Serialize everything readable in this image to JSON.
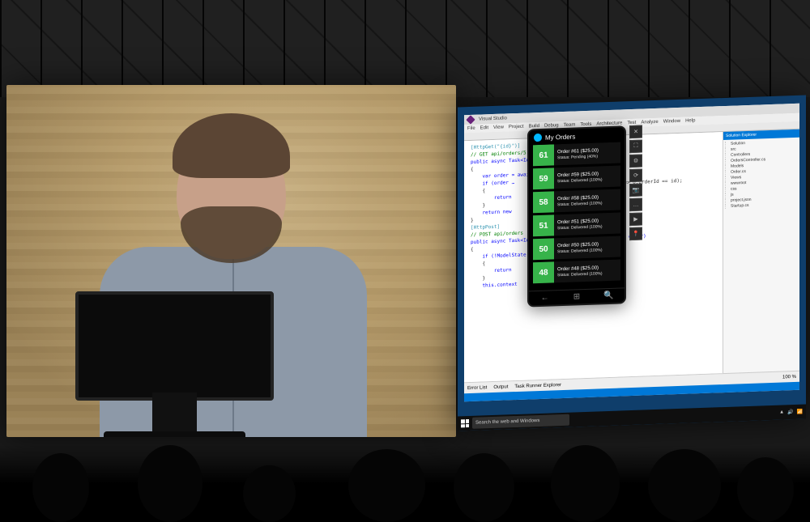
{
  "scene": {
    "description": "Conference stage with two projection screens: left shows a presenter at a podium, right shows a Windows 10 desktop running Visual Studio with a Windows Phone emulator in the foreground.",
    "audience_foreground": true
  },
  "ide": {
    "app_name": "Visual Studio",
    "menubar": [
      "File",
      "Edit",
      "View",
      "Project",
      "Build",
      "Debug",
      "Team",
      "Tools",
      "Architecture",
      "Test",
      "Analyze",
      "Window",
      "Help"
    ],
    "bottom_tabs": [
      "Error List",
      "Output",
      "Task Runner Explorer"
    ],
    "zoom": "100 %",
    "solution_explorer": {
      "title": "Solution Explorer",
      "items": [
        "Solution",
        "src",
        "  Controllers",
        "    OrdersController.cs",
        "  Models",
        "    Order.cs",
        "  Views",
        "  wwwroot",
        "    css",
        "    js",
        "  project.json",
        "  Startup.cs"
      ]
    },
    "code": {
      "lines": [
        {
          "cls": "code-attr",
          "text": "[HttpGet(\"{id}\")]"
        },
        {
          "cls": "code-comment",
          "text": "// GET api/orders/5"
        },
        {
          "cls": "code-kw",
          "text": "public async Task<IActionResult> Get(int id)"
        },
        {
          "cls": "",
          "text": "{"
        },
        {
          "cls": "code-kw",
          "text": "    var order = await _context."
        },
        {
          "cls": "code-kw",
          "text": "    if (order …"
        },
        {
          "cls": "",
          "text": "    {"
        },
        {
          "cls": "code-kw",
          "text": "        return"
        },
        {
          "cls": "",
          "text": "    }"
        },
        {
          "cls": "",
          "text": ""
        },
        {
          "cls": "code-kw",
          "text": "    return new"
        },
        {
          "cls": "",
          "text": "}"
        },
        {
          "cls": "",
          "text": ""
        },
        {
          "cls": "code-attr",
          "text": "[HttpPost]"
        },
        {
          "cls": "code-comment",
          "text": "// POST api/orders"
        },
        {
          "cls": "code-kw",
          "text": "public async Task<IActionResult> Post([FromBody]Order order)"
        },
        {
          "cls": "",
          "text": "{"
        },
        {
          "cls": "code-kw",
          "text": "    if (!ModelState"
        },
        {
          "cls": "",
          "text": "    {"
        },
        {
          "cls": "code-kw",
          "text": "        return"
        },
        {
          "cls": "",
          "text": "    }"
        },
        {
          "cls": "",
          "text": ""
        },
        {
          "cls": "code-kw",
          "text": "    this.context"
        }
      ],
      "fragment_behind_phone": "aultAsync(o => o.OrderId == id);"
    }
  },
  "phone": {
    "app_title": "My Orders",
    "orders": [
      {
        "num": "61",
        "title": "Order #61 ($25.00)",
        "status": "Status: Pending (40%)"
      },
      {
        "num": "59",
        "title": "Order #59 ($25.00)",
        "status": "Status: Delivered (100%)"
      },
      {
        "num": "58",
        "title": "Order #58 ($25.00)",
        "status": "Status: Delivered (100%)"
      },
      {
        "num": "51",
        "title": "Order #51 ($25.00)",
        "status": "Status: Delivered (100%)"
      },
      {
        "num": "50",
        "title": "Order #50 ($25.00)",
        "status": "Status: Delivered (100%)"
      },
      {
        "num": "48",
        "title": "Order #48 ($25.00)",
        "status": "Status: Delivered (100%)"
      }
    ],
    "softkeys": {
      "back": "←",
      "home": "⊞",
      "search": "🔍"
    },
    "emulator_tools": [
      "✕",
      "⛶",
      "⚙",
      "⟳",
      "📷",
      "…",
      "▶",
      "📍"
    ]
  },
  "taskbar": {
    "search_placeholder": "Search the web and Windows"
  }
}
